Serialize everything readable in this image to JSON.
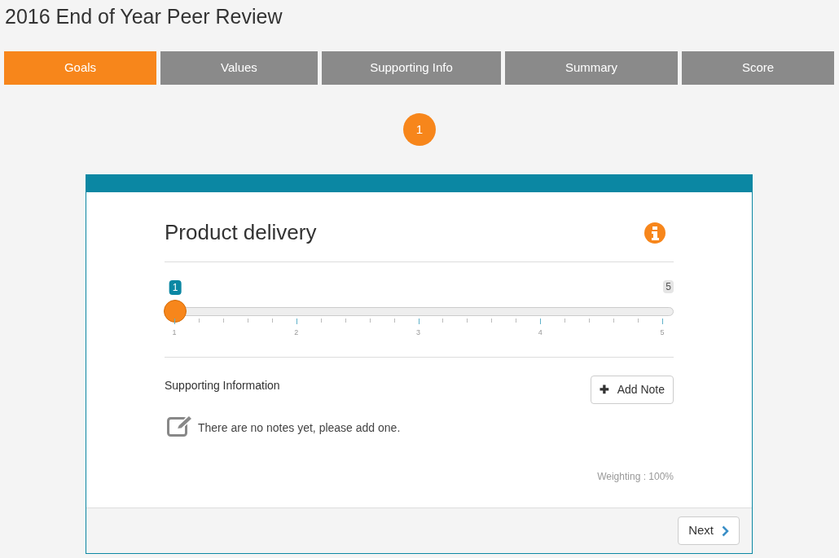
{
  "page_title": "2016 End of Year Peer Review",
  "tabs": [
    {
      "label": "Goals",
      "selected": true
    },
    {
      "label": "Values",
      "selected": false
    },
    {
      "label": "Supporting Info",
      "selected": false
    },
    {
      "label": "Summary",
      "selected": false
    },
    {
      "label": "Score",
      "selected": false
    }
  ],
  "step_badge": "1",
  "card": {
    "title": "Product delivery",
    "slider": {
      "value_label": "1",
      "max_label": "5",
      "level": 0,
      "tick_labels": [
        "1",
        "2",
        "3",
        "4",
        "5"
      ]
    },
    "supporting_heading": "Supporting Information",
    "add_note_button": "Add Note",
    "add_note_icon": "✚",
    "empty_message": "There are no notes yet, please add one.",
    "weighting": "Weighting : 100%",
    "next_button": "Next"
  }
}
